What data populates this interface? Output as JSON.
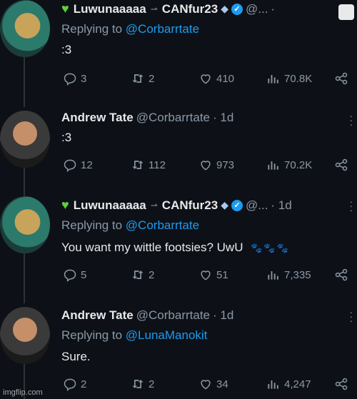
{
  "tweets": [
    {
      "name_left": "Luwunaaaaa",
      "arrow": "⇀",
      "name_right": "CANfur23",
      "handle": "@...",
      "time": "·",
      "replying_prefix": "Replying to",
      "replying_to": "@Corbarrtate",
      "text": ":3",
      "paws": "",
      "stats": {
        "replies": "3",
        "retweets": "2",
        "likes": "410",
        "views": "70.8K"
      }
    },
    {
      "name_left": "Andrew Tate",
      "handle": "@Corbarrtate",
      "time": "· 1d",
      "text": ":3",
      "paws": "",
      "stats": {
        "replies": "12",
        "retweets": "112",
        "likes": "973",
        "views": "70.2K"
      }
    },
    {
      "name_left": "Luwunaaaaa",
      "arrow": "⇀",
      "name_right": "CANfur23",
      "handle": "@...",
      "time": "· 1d",
      "replying_prefix": "Replying to",
      "replying_to": "@Corbarrtate",
      "text": "You want my wittle footsies? UwU",
      "paws": "🐾🐾🐾",
      "stats": {
        "replies": "5",
        "retweets": "2",
        "likes": "51",
        "views": "7,335"
      }
    },
    {
      "name_left": "Andrew Tate",
      "handle": "@Corbarrtate",
      "time": "· 1d",
      "replying_prefix": "Replying to",
      "replying_to": "@LunaManokit",
      "text": "Sure.",
      "paws": "",
      "stats": {
        "replies": "2",
        "retweets": "2",
        "likes": "34",
        "views": "4,247"
      }
    }
  ],
  "watermark": "imgflip.com",
  "icons": {
    "reply": "reply-icon",
    "retweet": "retweet-icon",
    "like": "heart-icon",
    "views": "views-icon",
    "share": "share-icon"
  },
  "colors": {
    "background": "#0d1117",
    "text": "#e7e9ea",
    "secondary": "#8b98a5",
    "link": "#1d9bf0",
    "verified": "#1d9bf0"
  }
}
